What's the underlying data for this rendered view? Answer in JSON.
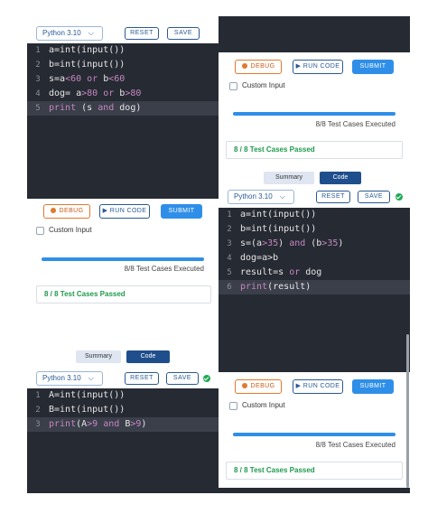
{
  "editor": {
    "language": "Python 3.10",
    "reset_label": "RESET",
    "save_label": "SAVE",
    "tabs": {
      "summary": "Summary",
      "code": "Code"
    }
  },
  "results": {
    "debug_label": "DEBUG",
    "run_label": "RUN CODE",
    "submit_label": "SUBMIT",
    "custom_input_label": "Custom Input",
    "executed_text": "8/8 Test Cases Executed",
    "passed_text": "8 / 8 Test Cases Passed",
    "progress": 1.0
  },
  "snippets": [
    {
      "lines": [
        [
          {
            "t": "a=int(input())"
          }
        ],
        [
          {
            "t": "b=int(input())"
          }
        ],
        [
          {
            "t": "s=a"
          },
          {
            "t": "<60",
            "c": "cmp"
          },
          {
            "t": " "
          },
          {
            "t": "or",
            "c": "kw"
          },
          {
            "t": " b"
          },
          {
            "t": "<60",
            "c": "cmp"
          }
        ],
        [
          {
            "t": "dog= a"
          },
          {
            "t": ">80",
            "c": "cmp"
          },
          {
            "t": " "
          },
          {
            "t": "or",
            "c": "kw"
          },
          {
            "t": " b"
          },
          {
            "t": ">80",
            "c": "cmp"
          }
        ],
        [
          {
            "t": "print",
            "c": "kw"
          },
          {
            "t": " (s "
          },
          {
            "t": "and",
            "c": "kw"
          },
          {
            "t": " dog)"
          }
        ]
      ]
    },
    {
      "lines": [
        [
          {
            "t": "a=int(input())"
          }
        ],
        [
          {
            "t": "b=int(input())"
          }
        ],
        [
          {
            "t": "s=(a"
          },
          {
            "t": ">35",
            "c": "cmp"
          },
          {
            "t": ") "
          },
          {
            "t": "and",
            "c": "kw"
          },
          {
            "t": " (b"
          },
          {
            "t": ">35",
            "c": "cmp"
          },
          {
            "t": ")"
          }
        ],
        [
          {
            "t": "dog=a>b"
          }
        ],
        [
          {
            "t": "result=s "
          },
          {
            "t": "or",
            "c": "kw"
          },
          {
            "t": " dog"
          }
        ],
        [
          {
            "t": "print",
            "c": "kw"
          },
          {
            "t": "(result)"
          }
        ]
      ]
    },
    {
      "lines": [
        [
          {
            "t": "A=int(input())"
          }
        ],
        [
          {
            "t": "B=int(input())"
          }
        ],
        [
          {
            "t": "print",
            "c": "kw"
          },
          {
            "t": "(A"
          },
          {
            "t": ">9",
            "c": "cmp"
          },
          {
            "t": " "
          },
          {
            "t": "and",
            "c": "kw"
          },
          {
            "t": " B"
          },
          {
            "t": ">9",
            "c": "cmp"
          },
          {
            "t": ")"
          }
        ]
      ]
    }
  ]
}
